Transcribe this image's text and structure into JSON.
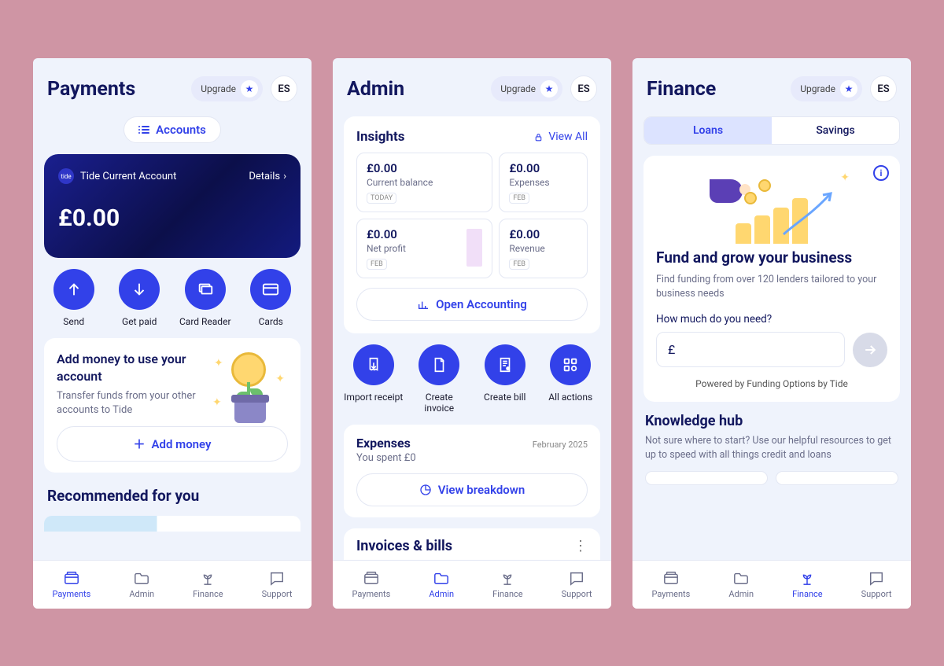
{
  "common": {
    "upgrade_label": "Upgrade",
    "avatar_initials": "ES"
  },
  "tabs": {
    "payments": "Payments",
    "admin": "Admin",
    "finance": "Finance",
    "support": "Support"
  },
  "payments": {
    "title": "Payments",
    "accounts_button": "Accounts",
    "card": {
      "brand_logo_text": "tide",
      "account_name": "Tide Current Account",
      "details_label": "Details",
      "balance": "£0.00"
    },
    "actions": {
      "send": "Send",
      "get_paid": "Get paid",
      "card_reader": "Card Reader",
      "cards": "Cards"
    },
    "add_money": {
      "title": "Add money to use your account",
      "sub": "Transfer funds from your other accounts to Tide",
      "button": "Add money"
    },
    "recommended_title": "Recommended for you"
  },
  "admin": {
    "title": "Admin",
    "insights": {
      "title": "Insights",
      "view_all": "View All",
      "open_accounting": "Open Accounting",
      "cards": [
        {
          "value": "£0.00",
          "label": "Current balance",
          "tag": "TODAY"
        },
        {
          "value": "£0.00",
          "label": "Expenses",
          "tag": "FEB"
        },
        {
          "value": "£0.00",
          "label": "Net profit",
          "tag": "FEB"
        },
        {
          "value": "£0.00",
          "label": "Revenue",
          "tag": "FEB"
        }
      ]
    },
    "actions": {
      "import_receipt": "Import receipt",
      "create_invoice": "Create invoice",
      "create_bill": "Create bill",
      "all_actions": "All actions"
    },
    "expenses": {
      "title": "Expenses",
      "sub": "You spent £0",
      "date": "February 2025",
      "button": "View breakdown"
    },
    "invoices_title": "Invoices & bills"
  },
  "finance": {
    "title": "Finance",
    "segments": {
      "loans": "Loans",
      "savings": "Savings"
    },
    "fund": {
      "heading": "Fund and grow your business",
      "sub": "Find funding from over 120 lenders tailored to your business needs",
      "q": "How much do you need?",
      "currency": "£",
      "powered": "Powered by Funding Options by Tide"
    },
    "kh": {
      "title": "Knowledge hub",
      "sub": "Not sure where to start? Use our helpful resources to get up to speed with all things credit and loans"
    }
  }
}
